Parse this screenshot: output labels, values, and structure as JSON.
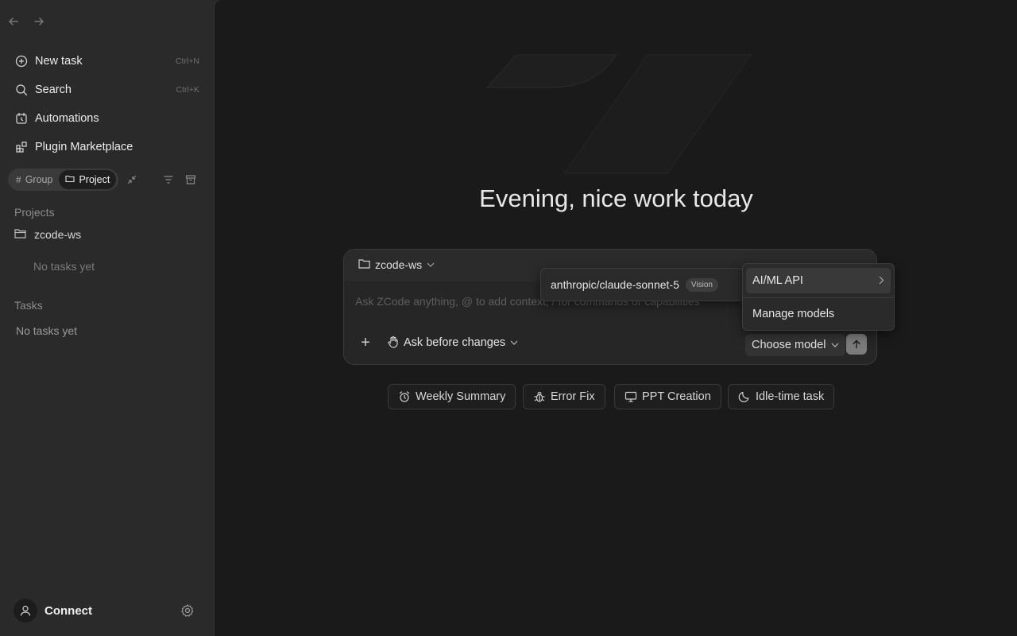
{
  "sidebar": {
    "new_task": {
      "label": "New task",
      "shortcut": "Ctrl+N"
    },
    "search": {
      "label": "Search",
      "shortcut": "Ctrl+K"
    },
    "automations": {
      "label": "Automations"
    },
    "plugin_marketplace": {
      "label": "Plugin Marketplace"
    },
    "view_toggle": {
      "group": "Group",
      "project": "Project",
      "active": "Project"
    },
    "projects_label": "Projects",
    "projects": [
      {
        "name": "zcode-ws",
        "empty": "No tasks yet"
      }
    ],
    "tasks_label": "Tasks",
    "tasks_empty": "No tasks yet",
    "connect_label": "Connect"
  },
  "main": {
    "greeting": "Evening, nice work today",
    "composer": {
      "folder": "zcode-ws",
      "placeholder": "Ask ZCode anything, @ to add context, / for commands or capabilities",
      "mode": "Ask before changes",
      "model_button": "Choose model"
    },
    "quick_actions": [
      "Weekly Summary",
      "Error Fix",
      "PPT Creation",
      "Idle-time task"
    ]
  },
  "model_menu": {
    "provider": "AI/ML API",
    "manage": "Manage models",
    "submenu": {
      "model": "anthropic/claude-sonnet-5",
      "badge": "Vision"
    }
  },
  "colors": {
    "sidebar_bg": "#2a2a2a",
    "main_bg": "#1a1a1a",
    "send_btn": "#7b7b7b"
  }
}
